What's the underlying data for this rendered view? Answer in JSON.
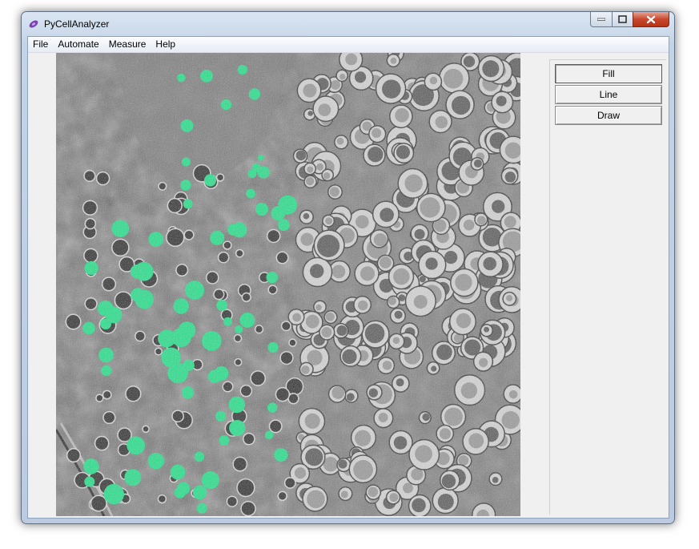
{
  "window": {
    "title": "PyCellAnalyzer"
  },
  "menu": {
    "items": [
      "File",
      "Automate",
      "Measure",
      "Help"
    ]
  },
  "tools": {
    "buttons": [
      "Fill",
      "Line",
      "Draw"
    ],
    "active": "Fill"
  },
  "image": {
    "description_icon": "micrograph-image"
  },
  "colors": {
    "overlay": "#1ee58a",
    "accent_close": "#c8482d"
  }
}
